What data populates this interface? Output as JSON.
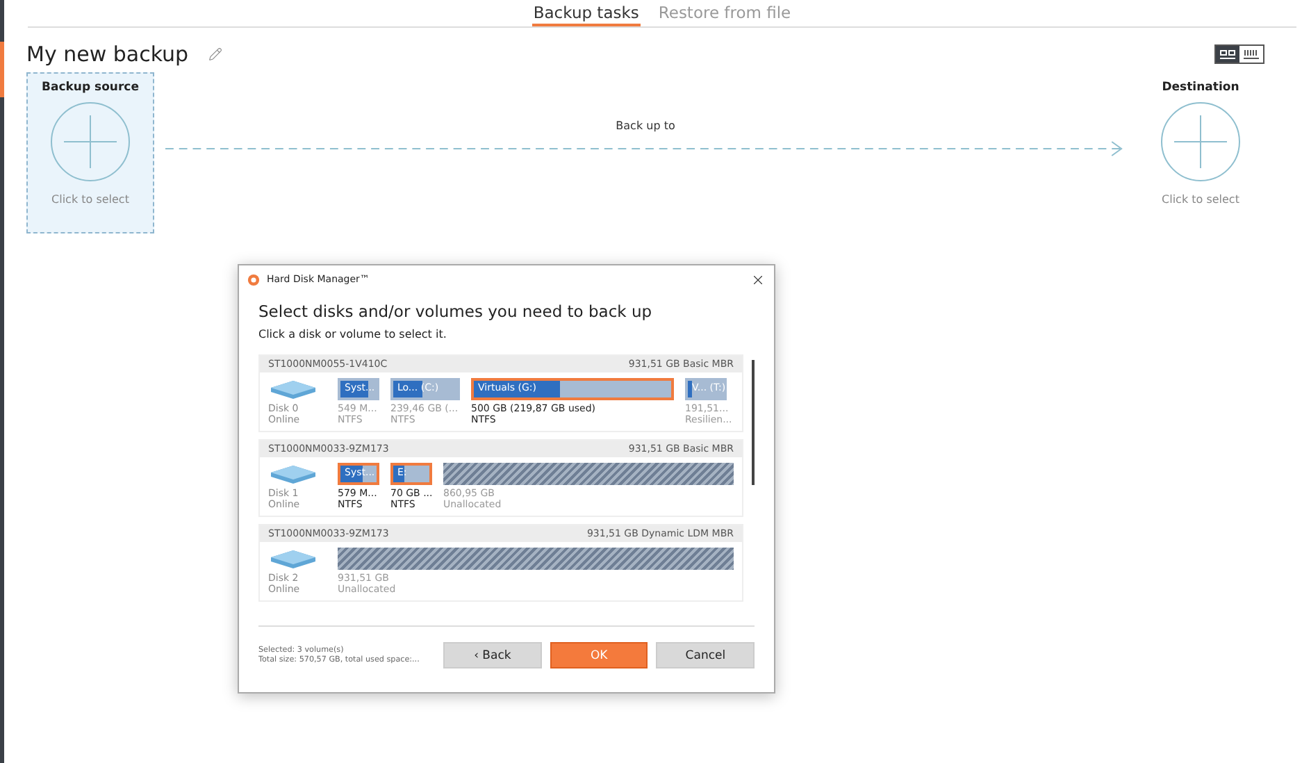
{
  "tabs": [
    {
      "label": "Backup tasks",
      "selected": true
    },
    {
      "label": "Restore from file",
      "selected": false
    }
  ],
  "title": "My new backup",
  "view_toggle": [
    {
      "selected": true
    },
    {
      "selected": false
    }
  ],
  "source": {
    "heading": "Backup source",
    "hint": "Click to select",
    "selected": true
  },
  "connector": {
    "label": "Back up to"
  },
  "destination": {
    "heading": "Destination",
    "hint": "Click to select",
    "selected": false
  },
  "dialog": {
    "title": "Hard Disk Manager™",
    "heading": "Select disks and/or volumes you need to back up",
    "subheading": "Click a disk or volume to select it.",
    "disks": [
      {
        "model": "ST1000NM0055-1V410C",
        "info": "931,51 GB Basic MBR",
        "name": "Disk 0",
        "status": "Online",
        "volumes": [
          {
            "kind": "volume",
            "label": "Syst...",
            "level": 0.75,
            "selected": false,
            "size": "549 M...",
            "fs": "NTFS"
          },
          {
            "kind": "volume",
            "label": "Lo... (C:)",
            "level": 0.45,
            "selected": false,
            "size": "239,46 GB (...",
            "fs": "NTFS"
          },
          {
            "kind": "volume",
            "label": "Virtuals (G:)",
            "level": 0.44,
            "selected": true,
            "size": "500 GB (219,87 GB used)",
            "fs": "NTFS"
          },
          {
            "kind": "volume",
            "label": "V... (T:)",
            "level": 0.1,
            "selected": false,
            "size": "191,51...",
            "fs": "Resilien..."
          }
        ]
      },
      {
        "model": "ST1000NM0033-9ZM173",
        "info": "931,51 GB Basic MBR",
        "name": "Disk 1",
        "status": "Online",
        "volumes": [
          {
            "kind": "volume",
            "label": "Syst...",
            "level": 0.6,
            "selected": true,
            "size": "579 M...",
            "fs": "NTFS"
          },
          {
            "kind": "volume",
            "label": "E:",
            "level": 0.3,
            "selected": true,
            "size": "70 GB ...",
            "fs": "NTFS"
          },
          {
            "kind": "unallocated",
            "size": "860,95 GB",
            "fs": "Unallocated"
          }
        ]
      },
      {
        "model": "ST1000NM0033-9ZM173",
        "info": "931,51 GB Dynamic LDM MBR",
        "name": "Disk 2",
        "status": "Online",
        "volumes": [
          {
            "kind": "unallocated",
            "size": "931,51 GB",
            "fs": "Unallocated"
          }
        ]
      }
    ],
    "summary": [
      "Selected: 3 volume(s)",
      "Total size: 570,57 GB, total used space:..."
    ],
    "buttons": [
      {
        "label": "‹ Back",
        "kind": "normal"
      },
      {
        "label": "OK",
        "kind": "primary"
      },
      {
        "label": "Cancel",
        "kind": "normal"
      }
    ]
  }
}
